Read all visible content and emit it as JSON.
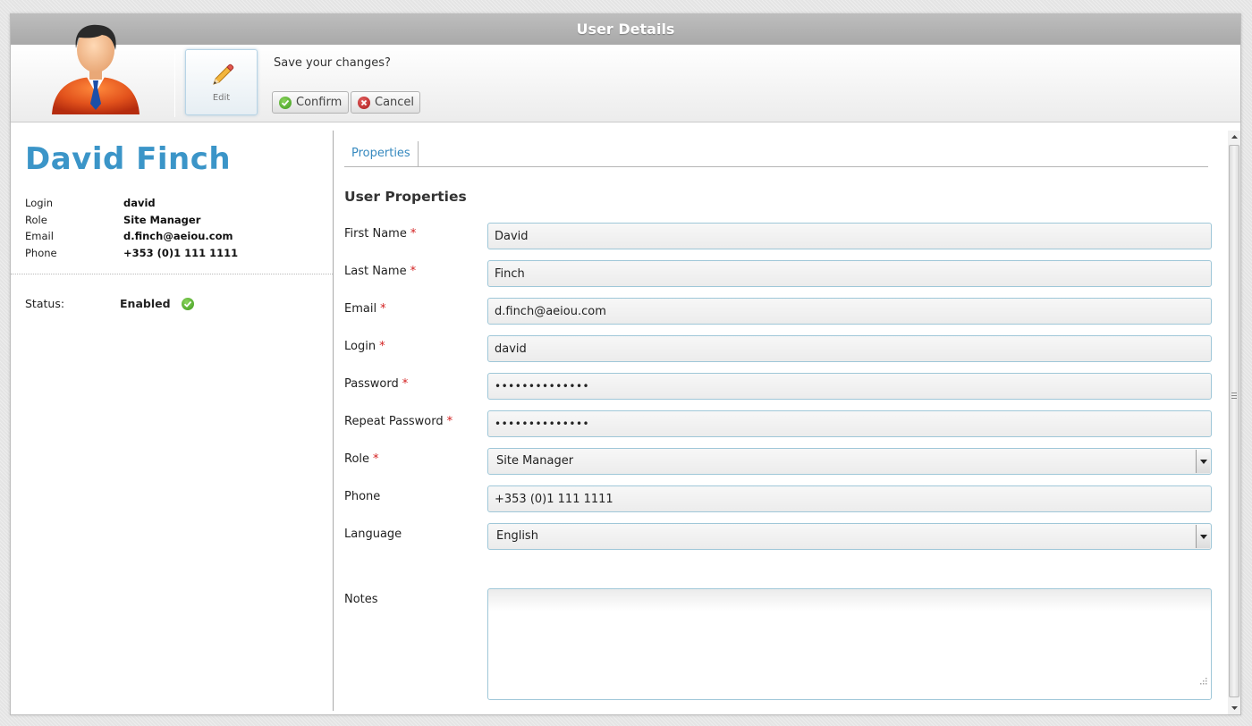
{
  "window": {
    "title": "User Details"
  },
  "toolbar": {
    "edit_label": "Edit",
    "save_prompt": "Save your changes?",
    "confirm_label": "Confirm",
    "cancel_label": "Cancel"
  },
  "profile": {
    "name": "David Finch",
    "info": [
      {
        "key": "Login",
        "value": "david"
      },
      {
        "key": "Role",
        "value": "Site Manager"
      },
      {
        "key": "Email",
        "value": "d.finch@aeiou.com"
      },
      {
        "key": "Phone",
        "value": "+353 (0)1 111 1111"
      }
    ],
    "status_label": "Status:",
    "status_value": "Enabled"
  },
  "tabs": [
    {
      "label": "Properties",
      "active": true
    }
  ],
  "form": {
    "title": "User Properties",
    "required_mark": "*",
    "fields": [
      {
        "label": "First Name",
        "value": "David",
        "required": true
      },
      {
        "label": "Last Name",
        "value": "Finch",
        "required": true
      },
      {
        "label": "Email",
        "value": "d.finch@aeiou.com",
        "required": true
      },
      {
        "label": "Login",
        "value": "david",
        "required": true
      },
      {
        "label": "Password",
        "value": "••••••••••••••",
        "required": true
      },
      {
        "label": "Repeat Password",
        "value": "••••••••••••••",
        "required": true
      },
      {
        "label": "Role",
        "value": "Site Manager",
        "required": true
      },
      {
        "label": "Phone",
        "value": "+353 (0)1 111 1111",
        "required": false
      },
      {
        "label": "Language",
        "value": "English",
        "required": false
      },
      {
        "label": "Notes",
        "value": "",
        "required": false
      }
    ]
  },
  "colors": {
    "accent": "#3b95c8",
    "tab_text": "#3689bf",
    "required": "#d32020",
    "field_border": "#9fc7d8",
    "titlebar": "#b5b5b5"
  }
}
